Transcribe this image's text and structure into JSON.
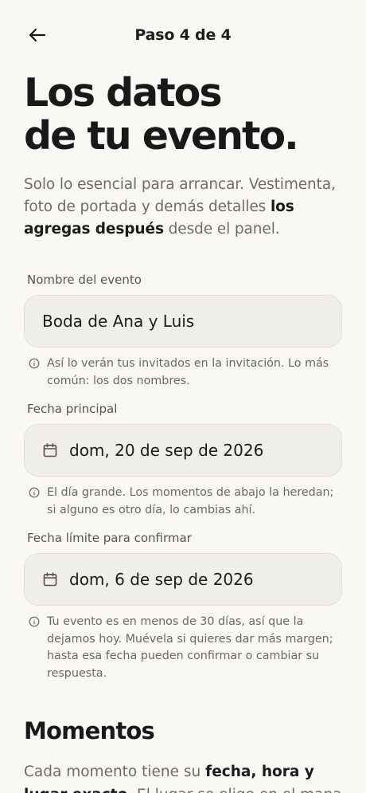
{
  "header": {
    "step": "Paso 4 de 4"
  },
  "title": {
    "line1": "Los datos",
    "line2": "de tu evento."
  },
  "intro": {
    "text1": "Solo lo esencial para arrancar. Vestimenta, foto de portada y demás detalles ",
    "bold": "los agregas después",
    "text2": " desde el panel."
  },
  "fields": {
    "name": {
      "label": "Nombre del evento",
      "value": "Boda de Ana y Luis",
      "hint": "Así lo verán tus invitados en la invitación. Lo más común: los dos nombres."
    },
    "date": {
      "label": "Fecha principal",
      "value": "dom, 20 de sep de 2026",
      "hint": "El día grande. Los momentos de abajo la heredan; si alguno es otro día, lo cambias ahí."
    },
    "deadline": {
      "label": "Fecha límite para confirmar",
      "value": "dom, 6 de sep de 2026",
      "hint": "Tu evento es en menos de 30 días, así que la dejamos hoy. Muévela si quieres dar más margen; hasta esa fecha pueden confirmar o cambiar su respuesta."
    }
  },
  "moments": {
    "title": "Momentos",
    "text1": "Cada momento tiene su ",
    "bold": "fecha, hora y lugar exacto",
    "text2": ". El lugar se elige en el mapa para que"
  },
  "icons": {
    "back": "arrow-left-icon",
    "calendar": "calendar-icon",
    "info": "info-icon"
  }
}
